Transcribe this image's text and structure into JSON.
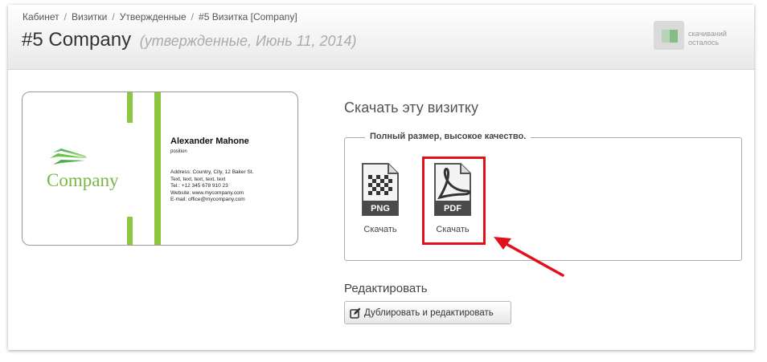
{
  "breadcrumb": {
    "items": [
      "Кабинет",
      "Визитки",
      "Утвержденные",
      "#5 Визитка [Company]"
    ],
    "separator": "/"
  },
  "page": {
    "title": "#5 Company",
    "subtitle": "(утвержденные, Июнь 11, 2014)"
  },
  "downloads_widget": {
    "line1": "скачиваний",
    "line2": "осталось",
    "icon": "downloads-badge-icon"
  },
  "card": {
    "company": "Company",
    "name": "Alexander Mahone",
    "position": "position",
    "contact_lines": [
      "Address: Country, City, 12 Baker St.",
      "Text, text, text, text, text",
      "Tel.: +12 345 678 910 23",
      "Website: www.mycompany.com",
      "E-mail: office@mycompany.com"
    ],
    "accent_color": "#8dc63f"
  },
  "download": {
    "heading": "Скачать эту визитку",
    "legend": "Полный размер, высокое качество.",
    "files": [
      {
        "format": "PNG",
        "action": "Скачать",
        "icon": "png-file-icon"
      },
      {
        "format": "PDF",
        "action": "Скачать",
        "icon": "pdf-file-icon"
      }
    ],
    "highlight_color": "#e3101a"
  },
  "edit": {
    "heading": "Редактировать",
    "button": "Дублировать и редактировать",
    "icon": "edit-icon"
  }
}
